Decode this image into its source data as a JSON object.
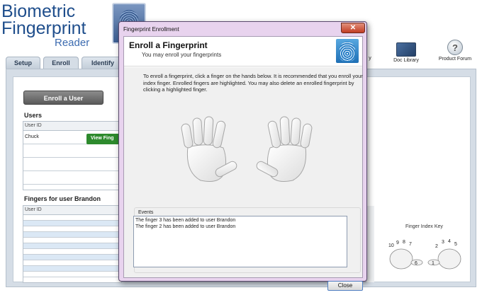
{
  "app": {
    "logo_line1": "Biometric",
    "logo_line2": "Fingerprint",
    "logo_line3": "Reader",
    "tabs": [
      "Setup",
      "Enroll",
      "Identify"
    ],
    "enroll_button": "Enroll a User",
    "users_title": "Users",
    "users_col": "User ID",
    "user_row_1": "Chuck",
    "view_fingers_label": "View Fing",
    "fingers_title_prefix": "Fingers for user",
    "fingers_user": "Brandon",
    "fingers_col": "User ID",
    "toolbar_partial": "y",
    "doc_library": "Doc Library",
    "product_forum": "Product Forum",
    "finger_index_key": "Finger Index Key",
    "finger_index_labels": [
      "10",
      "9",
      "8",
      "7",
      "6",
      "1",
      "2",
      "3",
      "4",
      "5"
    ]
  },
  "dialog": {
    "window_title": "Fingerprint Enrollment",
    "close_glyph": "✕",
    "heading": "Enroll a Fingerprint",
    "subheading": "You may enroll your fingerprints",
    "instructions": "To enroll a fingerprint, click a finger on the hands below.  It is recommended that you enroll your index finger.  Enrolled fingers are highlighted.  You may also delete an enrolled fingerprint by clicking a highlighted finger.",
    "events_label": "Events",
    "events": [
      "The finger 3 has been added to user Brandon",
      "The finger 2 has been added to user Brandon"
    ],
    "close_button": "Close"
  }
}
